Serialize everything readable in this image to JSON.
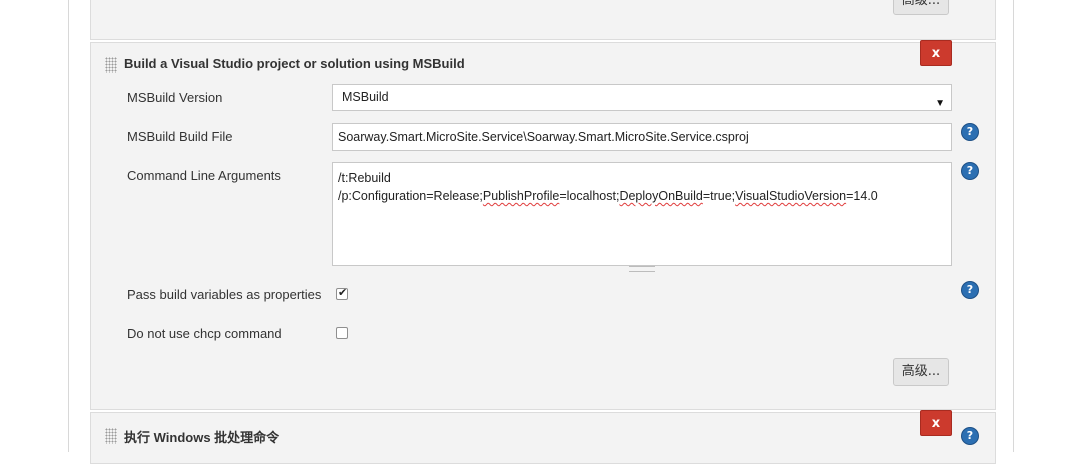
{
  "top_section": {
    "advanced_button": "高级..."
  },
  "msbuild_section": {
    "title": "Build a Visual Studio project or solution using MSBuild",
    "delete_button": "x",
    "msbuild_version": {
      "label": "MSBuild Version",
      "value": "MSBuild"
    },
    "build_file": {
      "label": "MSBuild Build File",
      "value": "Soarway.Smart.MicroSite.Service\\Soarway.Smart.MicroSite.Service.csproj"
    },
    "cmd_args": {
      "label": "Command Line Arguments",
      "line1": "/t:Rebuild",
      "line2_parts": [
        "/p:Configuration=Release;",
        "PublishProfile",
        "=localhost;",
        "DeployOnBuild",
        "=true;",
        "VisualStudioVersion",
        "=14.0"
      ]
    },
    "pass_build_vars": {
      "label": "Pass build variables as properties",
      "checked": true
    },
    "no_chcp": {
      "label": "Do not use chcp command",
      "checked": false
    },
    "advanced_button": "高级...",
    "help_icon": "?"
  },
  "windows_section": {
    "title": "执行 Windows 批处理命令",
    "delete_button": "x"
  },
  "colors": {
    "delete": "#cc3a2d",
    "help": "#2c6fb2",
    "section_bg": "#f3f3f3"
  }
}
